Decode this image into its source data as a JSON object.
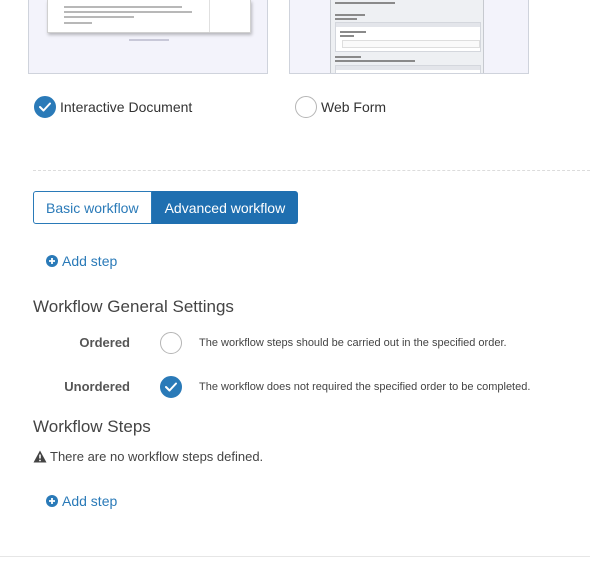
{
  "templates": {
    "options": [
      {
        "label": "Interactive Document",
        "selected": true
      },
      {
        "label": "Web Form",
        "selected": false
      }
    ]
  },
  "workflow_toggle": {
    "basic_label": "Basic workflow",
    "advanced_label": "Advanced workflow",
    "active": "advanced"
  },
  "add_step_label": "Add step",
  "general_settings": {
    "title": "Workflow General Settings",
    "ordered": {
      "label": "Ordered",
      "description": "The workflow steps should be carried out in the specified order.",
      "selected": false
    },
    "unordered": {
      "label": "Unordered",
      "description": "The workflow does not required the specified order to be completed.",
      "selected": true
    }
  },
  "workflow_steps": {
    "title": "Workflow Steps",
    "empty_message": "There are no workflow steps defined."
  },
  "colors": {
    "accent": "#2a7ab8",
    "active_button": "#1f6fb0"
  },
  "icons": [
    "check-icon",
    "plus-circle-icon",
    "warning-triangle-icon"
  ]
}
